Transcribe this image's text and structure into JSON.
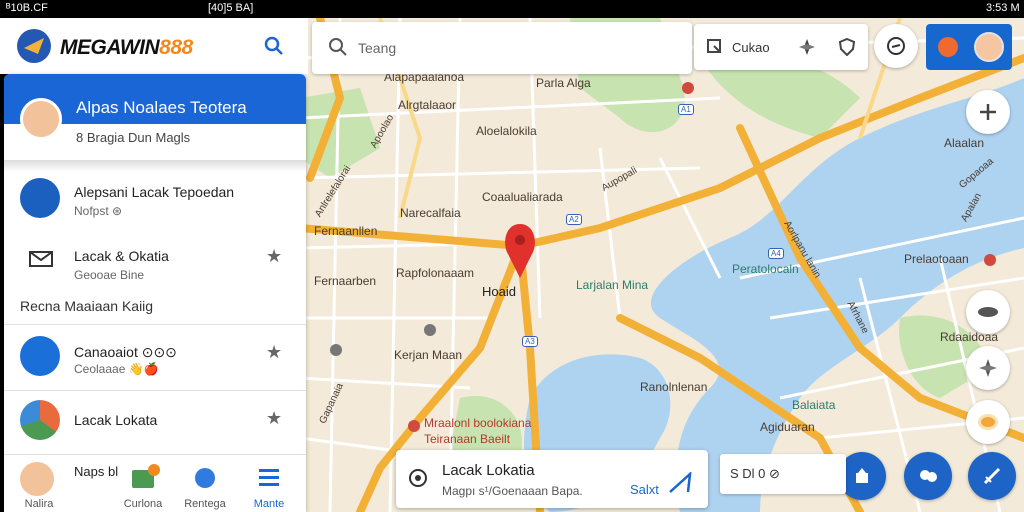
{
  "status_bar": {
    "left": "ᴮ10B.CF",
    "mid": "[40]5 BA]",
    "time": "3:53 M"
  },
  "app": {
    "brand_word": "MEGAWIN",
    "brand_num": "888"
  },
  "left_panel": {
    "title": "Alpas Noalaes Teotera",
    "subtitle": "8 Bragia Dun Magls",
    "items": [
      {
        "title": "Alepsani Lacak Tepoedan",
        "sub": "Nofpst ⊛"
      },
      {
        "title": "Lacak & Okatia",
        "sub": "Geooae Bine"
      }
    ],
    "section_label": "Recna Maaiaan Kaiig",
    "recent": [
      {
        "title": "Canaoaiot ⊙⊙⊙",
        "sub": "Ceolaaae 👋🍎"
      },
      {
        "title": "Lacak Lokata",
        "sub": ""
      }
    ],
    "bottom_nav": [
      {
        "label": "Nalira",
        "title": "Naps bl"
      },
      {
        "label": "Curlona"
      },
      {
        "label": "Rentega"
      },
      {
        "label": "Mante"
      }
    ]
  },
  "map": {
    "search_placeholder": "Teang",
    "cluster_label": "Cukao",
    "labels": {
      "top1": "Alapapaalanoa",
      "top2": "Parla Alga",
      "b1": "Alrgtalaaor",
      "b2": "Aloelalokila",
      "b3": "Coaalualiarada",
      "b4": "Narecalfaia",
      "b5": "Fernaarben",
      "b6": "Rapfolonaaam",
      "b7": "Hoaid",
      "b8": "Kerjan Maan",
      "b9": "Fernaanllen",
      "b10": "Ranolnlenan",
      "b11": "Agiduaran",
      "b12": "Mraalonl boolokiana",
      "b13": "Teiranaan Baeilt",
      "w1": "Larjalan Mina",
      "w2": "Peratolocaln",
      "w3": "Balaiata",
      "r1": "Prelaotoaan",
      "r2": "Rdaaidoaa",
      "r3": "Alaalan",
      "road1": "Aupopali",
      "road2": "Anlrelefalorai",
      "road3": "Aorlpanu lanin",
      "road4": "Afrhane",
      "road5": "Apoolao",
      "road6": "Apalan",
      "road7": "Gapanaia",
      "road8": "Gopaoaa"
    },
    "route_badges": [
      "A1",
      "A2",
      "A3",
      "A4"
    ]
  },
  "bottom_card": {
    "title": "Lacak Lokatia",
    "subtitle": "Magpı s¹/Goenaaan Bapa.",
    "action": "Salxt"
  },
  "coord_box": "S Dl   0 ⊘",
  "colors": {
    "primary": "#1a66d6",
    "road": "#f2b136",
    "water": "#aed3f1",
    "park": "#c7e3b0"
  }
}
